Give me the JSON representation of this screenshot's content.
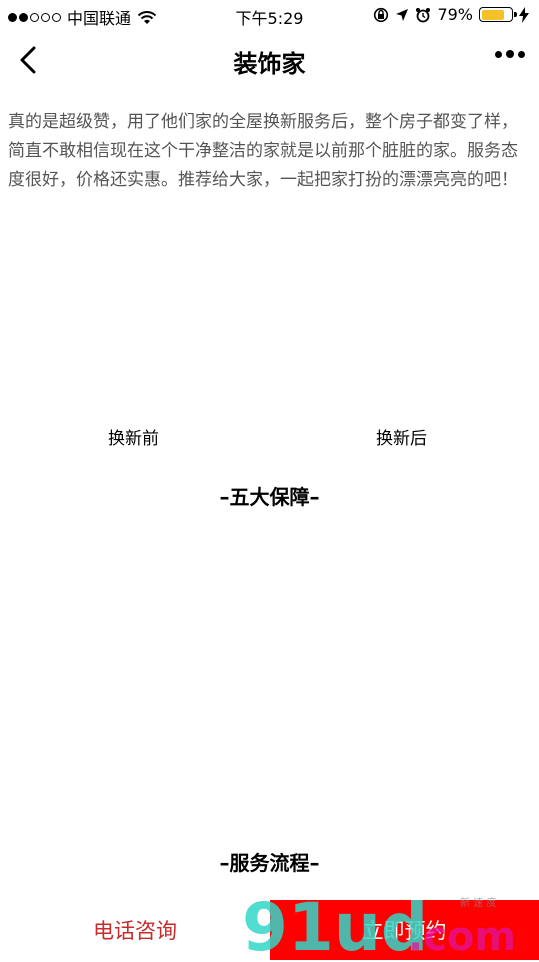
{
  "status_bar": {
    "carrier": "中国联通",
    "time": "下午5:29",
    "battery": "79%",
    "battery_level": 0.79
  },
  "nav": {
    "title": "装饰家"
  },
  "review": {
    "text": "真的是超级赞，用了他们家的全屋换新服务后，整个房子都变了样，简直不敢相信现在这个干净整洁的家就是以前那个脏脏的家。服务态度很好，价格还实惠。推荐给大家，一起把家打扮的漂漂亮亮的吧！"
  },
  "compare": {
    "before_label": "换新前",
    "after_label": "换新后"
  },
  "sections": {
    "guarantees_title": "–五大保障–",
    "process_title": "–服务流程–"
  },
  "bottom_bar": {
    "call_label": "电话咨询",
    "book_label": "立即预约"
  },
  "watermark": {
    "text": "91ud.com",
    "subtext": "新 速 度"
  },
  "colors": {
    "accent_red": "#ff0000",
    "call_text": "#c92a2a",
    "battery_fill": "#f6c028",
    "review_text": "#555555",
    "watermark_cyan": "#33d6c8",
    "watermark_magenta": "#e0139c"
  }
}
